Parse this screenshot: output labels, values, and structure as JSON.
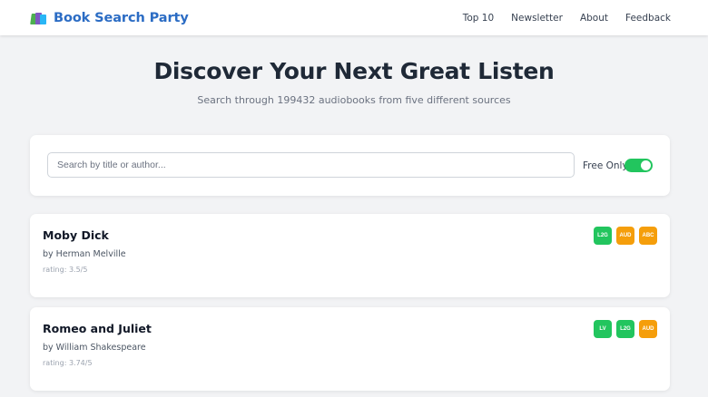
{
  "brand": {
    "title": "Book Search Party",
    "logo_icon": "books-icon"
  },
  "nav": {
    "links": [
      {
        "label": "Top 10"
      },
      {
        "label": "Newsletter"
      },
      {
        "label": "About"
      },
      {
        "label": "Feedback"
      }
    ]
  },
  "hero": {
    "title": "Discover Your Next Great Listen",
    "subtitle": "Search through 199432 audiobooks from five different sources"
  },
  "search": {
    "placeholder": "Search by title or author...",
    "value": "",
    "free_only_label": "Free Only",
    "free_only_enabled": true
  },
  "books": [
    {
      "title": "Moby Dick",
      "author": "by Herman Melville",
      "rating": "rating: 3.5/5",
      "badges": [
        {
          "label": "L2G",
          "color": "#22c55e"
        },
        {
          "label": "AUD",
          "color": "#f59e0b"
        },
        {
          "label": "ABC",
          "color": "#f59e0b"
        }
      ]
    },
    {
      "title": "Romeo and Juliet",
      "author": "by William Shakespeare",
      "rating": "rating: 3.74/5",
      "badges": [
        {
          "label": "LV",
          "color": "#22c55e"
        },
        {
          "label": "L2G",
          "color": "#22c55e"
        },
        {
          "label": "AUD",
          "color": "#f59e0b"
        }
      ]
    }
  ],
  "colors": {
    "brand": "#2b6cc4",
    "toggle_on": "#22c55e",
    "badge_green": "#22c55e",
    "badge_orange": "#f59e0b",
    "background": "#f2f3f5"
  }
}
